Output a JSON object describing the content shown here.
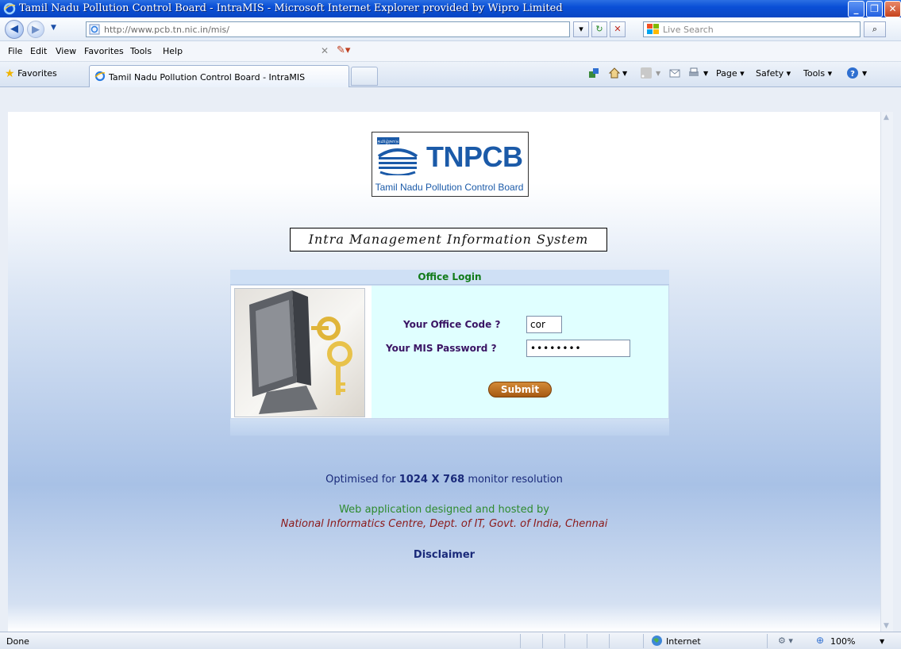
{
  "window": {
    "title": "Tamil Nadu Pollution Control Board - IntraMIS - Microsoft Internet Explorer provided by Wipro Limited"
  },
  "address_bar": {
    "url": "http://www.pcb.tn.nic.in/mis/",
    "search_placeholder": "Live Search"
  },
  "menu": {
    "items": [
      "File",
      "Edit",
      "View",
      "Favorites",
      "Tools",
      "Help"
    ]
  },
  "tabs": {
    "favorites_label": "Favorites",
    "active_tab_title": "Tamil Nadu Pollution Control Board - IntraMIS"
  },
  "command_bar": {
    "page_label": "Page",
    "safety_label": "Safety",
    "tools_label": "Tools"
  },
  "logo": {
    "abbreviation": "TNPCB",
    "full_name": "Tamil Nadu Pollution Control Board",
    "script_text": "தமிழ்நாடு"
  },
  "banner": {
    "text": "Intra Management Information System"
  },
  "login": {
    "header": "Office Login",
    "office_code_label": "Your Office Code ?",
    "office_code_value": "cor",
    "password_label": "Your MIS Password ?",
    "password_value": "••••••••",
    "submit_label": "Submit"
  },
  "footer": {
    "optimised_prefix": "Optimised for",
    "resolution": "1024 X 768",
    "optimised_suffix": "monitor resolution",
    "designed_by": "Web application designed and hosted by",
    "nic": "National Informatics Centre, Dept. of IT, Govt. of India, Chennai",
    "disclaimer": "Disclaimer"
  },
  "status_bar": {
    "status": "Done",
    "zone": "Internet",
    "zoom": "100%"
  }
}
